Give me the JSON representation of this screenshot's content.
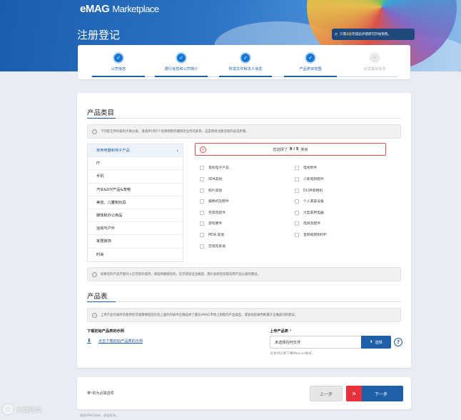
{
  "header": {
    "logo_text": "eMAG",
    "logo_suffix": "Marketplace",
    "title": "注册登记",
    "notice_prefix": "只需",
    "notice_bold": "2分",
    "notice_suffix": "完成此步骤即可开始销售。"
  },
  "steps": [
    {
      "label": "公司信息",
      "state": "done"
    },
    {
      "label": "银行信息和公司简介",
      "state": "done"
    },
    {
      "label": "所需文件和法人信息",
      "state": "done"
    },
    {
      "label": "产品类目范围",
      "state": "active"
    },
    {
      "label": "运营基础信息",
      "state": "pending"
    }
  ],
  "categories_section": {
    "title": "产品类目",
    "info": "下列是全目列表的大致分类，请选择1到5个您想销售的最接近业务的类目，这是继续注册流程的必选步骤。",
    "selected_text_prefix": "您选择了",
    "selected_count": "0 / 5",
    "selected_text_suffix": "类目",
    "list": [
      "家用电器和电子产品",
      "IT",
      "手机",
      "汽车&DIY产品&宠物",
      "美容、儿童和玩具",
      "媒体和办公用品",
      "运动与户外",
      "家居装饰",
      "时尚"
    ],
    "subcategories_left": [
      "其他电子产品",
      "SDA其他",
      "照片其他",
      "摄像机及配件",
      "空调及配件",
      "游戏硬件",
      "MDA 其他",
      "空调及其他"
    ],
    "subcategories_right": [
      "电视附件",
      "小家电和配件",
      "DLSR照相机",
      "个人美容设备",
      "大型家用电器",
      "电视及配件",
      "音频视频和HiFi"
    ],
    "footer_info": "如果您的产品不能归入任何现有类目，请选择最接近的，在完成验证注册后，我们会给您权限去用产品分类的建议。"
  },
  "product_table": {
    "title": "产品表",
    "info": "上传产品列表所有使用您可能需要提前在您上面的列表中正确选择了最在eMAG市场上销售的产品类型，或者助您做判断属于正确类别的建议。",
    "download_title": "下载初始产品表的示例",
    "download_link": "点击下载初始产品表的示例",
    "upload_title": "上传产品表",
    "upload_required": "*",
    "upload_value": "未选择任何文件",
    "upload_button": "选择",
    "upload_hint": "仅支持之前下载的excel格式。",
    "help": "?"
  },
  "footer": {
    "required_prefix": "带",
    "required_star": "*",
    "required_suffix": "的为必填选项",
    "prev": "上一步",
    "next": "下一步",
    "copyright": "版权eMAG所有，保留权利。"
  },
  "watermark": "大数跨境",
  "colors": {
    "primary": "#1f5fa8",
    "danger": "#d9534f",
    "next_accent": "#e8313a"
  }
}
